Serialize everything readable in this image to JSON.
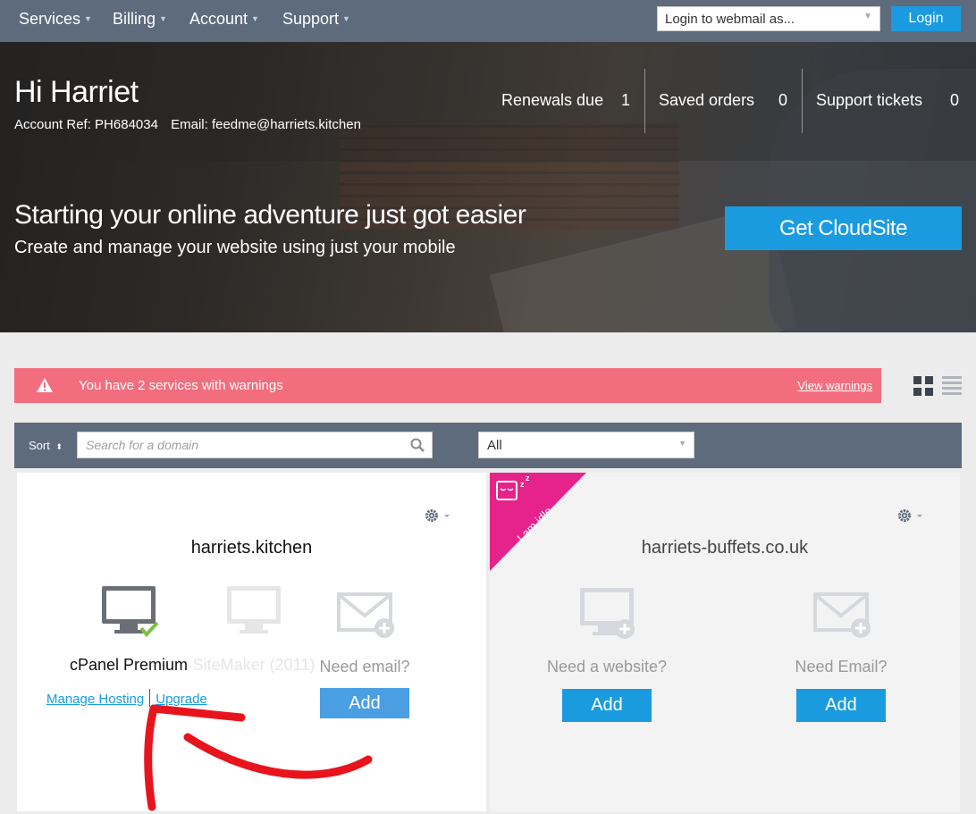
{
  "nav": {
    "items": [
      "Services",
      "Billing",
      "Account",
      "Support"
    ],
    "webmail_placeholder": "Login to webmail as...",
    "login_label": "Login"
  },
  "header": {
    "greeting": "Hi Harriet",
    "account_ref": "Account Ref: PH684034",
    "email": "Email: feedme@harriets.kitchen",
    "stats": [
      {
        "label": "Renewals due",
        "value": "1"
      },
      {
        "label": "Saved orders",
        "value": "0"
      },
      {
        "label": "Support tickets",
        "value": "0"
      }
    ]
  },
  "promo": {
    "title": "Starting your online adventure just got easier",
    "subtitle": "Create and manage your website using just your mobile",
    "button_label": "Get CloudSite"
  },
  "warning": {
    "text": "You have 2 services with warnings",
    "link": "View warnings",
    "color": "#f26e7e"
  },
  "filter": {
    "sort_label": "Sort",
    "search_placeholder": "Search for a domain",
    "select_value": "All"
  },
  "cards": [
    {
      "domain": "harriets.kitchen",
      "services": [
        {
          "label": "cPanel Premium",
          "icon": "monitor-check-icon"
        },
        {
          "label": "SiteMaker (2011)",
          "icon": "monitor-icon"
        },
        {
          "label": "Need email?",
          "icon": "envelope-plus-icon",
          "button": "Add"
        }
      ],
      "links": [
        "Manage Hosting",
        "Upgrade"
      ]
    },
    {
      "ribbon": "I am idle",
      "domain": "harriets-buffets.co.uk",
      "services": [
        {
          "label": "Need a website?",
          "icon": "monitor-plus-icon",
          "button": "Add"
        },
        {
          "label": "Need Email?",
          "icon": "envelope-plus-icon",
          "button": "Add"
        }
      ]
    }
  ],
  "colors": {
    "accent": "#1a9be0",
    "nav": "#5d6b7d",
    "ribbon": "#e5238a",
    "annotation_arrow": "#e8141c"
  }
}
